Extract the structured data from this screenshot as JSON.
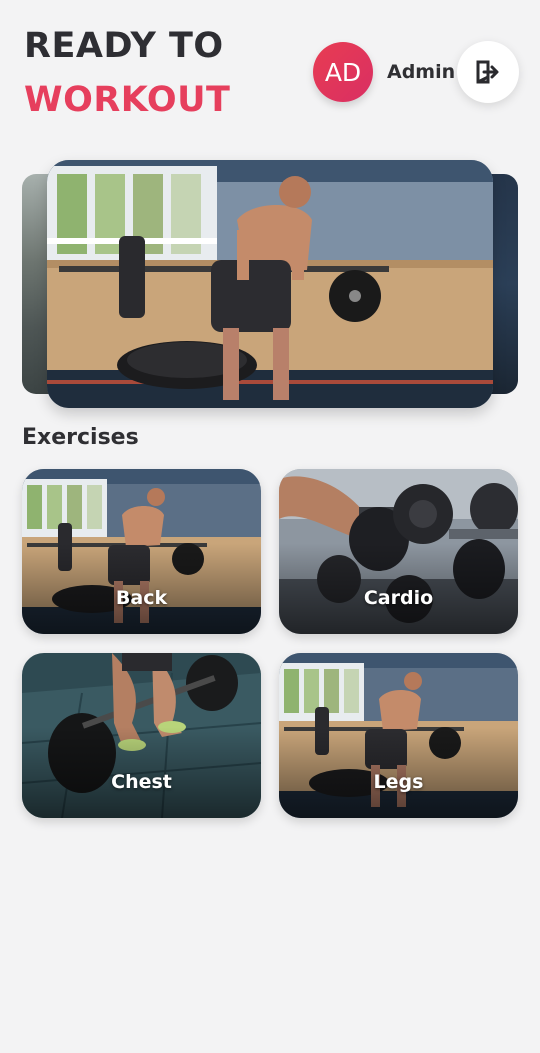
{
  "header": {
    "title_line1": "READY TO",
    "title_line2": "WORKOUT",
    "avatar_initials": "AD",
    "user_name": "Admin",
    "logout_icon": "logout-icon"
  },
  "carousel": {
    "current_slide_image": "barbell-row-photo"
  },
  "exercises": {
    "section_title": "Exercises",
    "cards": [
      {
        "label": "Back",
        "image": "barbell-row-photo"
      },
      {
        "label": "Cardio",
        "image": "dumbbell-rack-photo"
      },
      {
        "label": "Chest",
        "image": "deadlift-plates-photo"
      },
      {
        "label": "Legs",
        "image": "barbell-row-photo"
      }
    ]
  },
  "colors": {
    "accent": "#e63f5d",
    "title_dark": "#2e2e33",
    "background": "#f3f3f4"
  }
}
